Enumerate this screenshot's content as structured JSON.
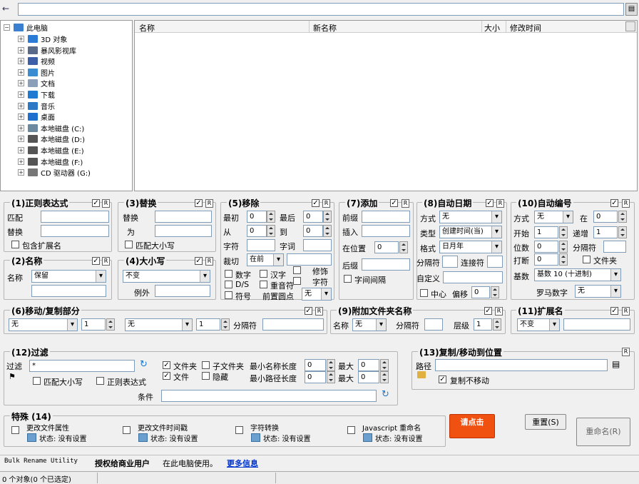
{
  "toolbar": {
    "path": ""
  },
  "tree": {
    "root": "此电脑",
    "items": [
      {
        "label": "3D 对象",
        "icon": "folder-3d-icon",
        "color": "#2a7bd6"
      },
      {
        "label": "暴风影视库",
        "icon": "video-library-icon",
        "color": "#5a6b8a"
      },
      {
        "label": "视频",
        "icon": "video-folder-icon",
        "color": "#3d5fa8"
      },
      {
        "label": "图片",
        "icon": "pictures-folder-icon",
        "color": "#3a8dd0"
      },
      {
        "label": "文档",
        "icon": "documents-folder-icon",
        "color": "#8aa0b8"
      },
      {
        "label": "下载",
        "icon": "downloads-folder-icon",
        "color": "#1f7ad1"
      },
      {
        "label": "音乐",
        "icon": "music-folder-icon",
        "color": "#2b78c5"
      },
      {
        "label": "桌面",
        "icon": "desktop-folder-icon",
        "color": "#1e6fce"
      },
      {
        "label": "本地磁盘 (C:)",
        "icon": "drive-c-icon",
        "color": "#6b8aa0"
      },
      {
        "label": "本地磁盘 (D:)",
        "icon": "drive-icon",
        "color": "#555"
      },
      {
        "label": "本地磁盘 (E:)",
        "icon": "drive-icon",
        "color": "#555"
      },
      {
        "label": "本地磁盘 (F:)",
        "icon": "drive-icon",
        "color": "#555"
      },
      {
        "label": "CD 驱动器 (G:)",
        "icon": "cd-drive-icon",
        "color": "#777"
      }
    ]
  },
  "filelist": {
    "columns": [
      "名称",
      "新名称",
      "大小",
      "修改时间"
    ]
  },
  "g1": {
    "title": "(1)正则表达式",
    "match": "匹配",
    "replace": "替换",
    "ext": "包含扩展名"
  },
  "g2": {
    "title": "(2)名称",
    "label": "名称",
    "value": "保留"
  },
  "g3": {
    "title": "(3)替换",
    "replace": "替换",
    "with": "为",
    "case": "匹配大小写"
  },
  "g4": {
    "title": "(4)大小写",
    "value": "不变",
    "except": "例外"
  },
  "g5": {
    "title": "(5)移除",
    "first": "最初",
    "last": "最后",
    "from": "从",
    "to": "到",
    "chars": "字符",
    "words": "字词",
    "crop": "裁切",
    "crop_value": "在前",
    "digits": "数字",
    "chinese": "汉字",
    "trim": "修饰",
    "ds": "D/S",
    "accents": "重音符",
    "char2": "字符",
    "symbols": "符号",
    "lead_dots": "前置圆点",
    "lead_value": "无",
    "n0": "0",
    "n1": "0",
    "n2": "0",
    "n3": "0"
  },
  "g7": {
    "title": "(7)添加",
    "prefix": "前缀",
    "insert": "插入",
    "at_pos": "在位置",
    "at_value": "0",
    "suffix": "后缀",
    "word_space": "字间间隔"
  },
  "g8": {
    "title": "(8)自动日期",
    "mode": "方式",
    "mode_value": "无",
    "type": "类型",
    "type_value": "创建时间(当)",
    "format": "格式",
    "format_value": "日月年",
    "sep": "分隔符",
    "concat": "连接符",
    "custom": "自定义",
    "center": "中心",
    "offset": "偏移",
    "offset_value": "0"
  },
  "g10": {
    "title": "(10)自动编号",
    "mode": "方式",
    "mode_value": "无",
    "at": "在",
    "at_value": "0",
    "start": "开始",
    "start_value": "1",
    "inc": "递增",
    "inc_value": "1",
    "digits": "位数",
    "digits_value": "0",
    "sep": "分隔符",
    "break": "打断",
    "break_value": "0",
    "folder": "文件夹",
    "base": "基数",
    "base_value": "基数 10 (十进制)",
    "roman": "罗马数字",
    "roman_value": "无"
  },
  "g6": {
    "title": "(6)移动/复制部分",
    "v1": "无",
    "n1": "1",
    "v2": "无",
    "n2": "1",
    "sep": "分隔符"
  },
  "g9": {
    "title": "(9)附加文件夹名称",
    "name": "名称",
    "name_value": "无",
    "sep": "分隔符",
    "levels": "层级",
    "levels_value": "1"
  },
  "g11": {
    "title": "(11)扩展名",
    "value": "不变"
  },
  "g12": {
    "title": "(12)过滤",
    "filter": "过滤",
    "mask": "*",
    "case": "匹配大小写",
    "regex": "正则表达式",
    "folders": "文件夹",
    "subfolders": "子文件夹",
    "files": "文件",
    "hidden": "隐藏",
    "min_name": "最小名称长度",
    "min_path": "最小路径长度",
    "max": "最大",
    "max2": "最大",
    "v": "0",
    "cond": "条件"
  },
  "g13": {
    "title": "(13)复制/移动到位置",
    "path": "路径",
    "no_move": "复制不移动"
  },
  "special": {
    "title": "特殊 (14)",
    "items": [
      {
        "label": "更改文件属性",
        "status": "状态: 没有设置"
      },
      {
        "label": "更改文件时间戳",
        "status": "状态: 没有设置"
      },
      {
        "label": "字符转换",
        "status": "状态: 没有设置"
      },
      {
        "label": "Javascript 重命名",
        "status": "状态: 没有设置"
      }
    ]
  },
  "actions": {
    "promo": "请点击",
    "reset": "重置(S)",
    "rename": "重命名(R)"
  },
  "footer": {
    "app": "Bulk Rename Utility",
    "licensed": "授权给商业用户",
    "pc": "在此电脑使用。",
    "more": "更多信息"
  },
  "statusbar": {
    "objects": "0 个对象(0 个已选定)"
  },
  "flags": {
    "r": "R",
    "on": "✓"
  }
}
